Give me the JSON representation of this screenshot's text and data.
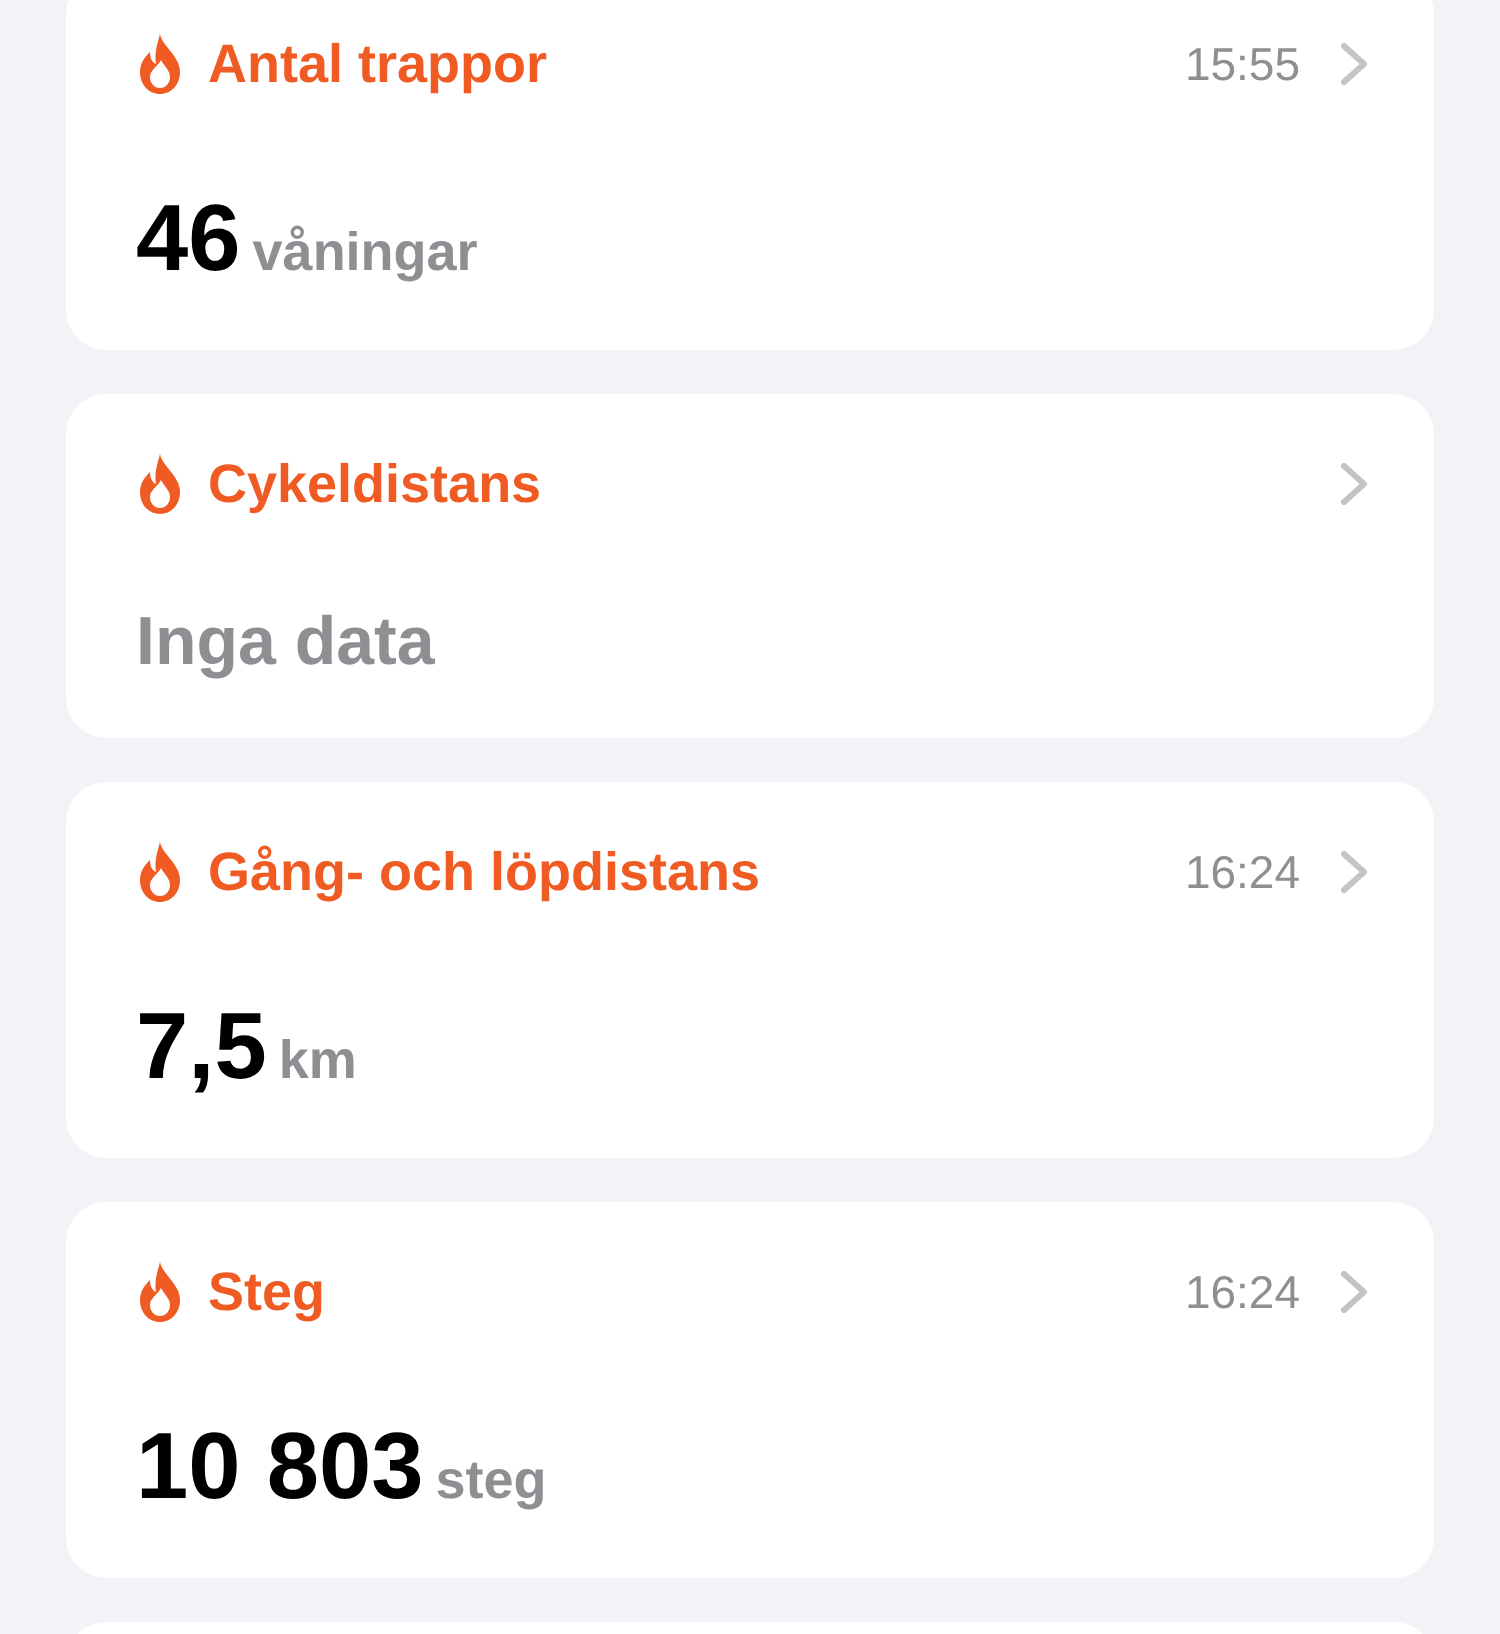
{
  "cards": [
    {
      "kind": "value",
      "title": "Antal trappor",
      "time": "15:55",
      "value": "46",
      "unit": "våningar"
    },
    {
      "kind": "empty",
      "title": "Cykeldistans",
      "message": "Inga data"
    },
    {
      "kind": "value",
      "title": "Gång- och löpdistans",
      "time": "16:24",
      "value": "7,5",
      "unit": "km"
    },
    {
      "kind": "value",
      "title": "Steg",
      "time": "16:24",
      "value": "10 803",
      "unit": "steg"
    }
  ]
}
